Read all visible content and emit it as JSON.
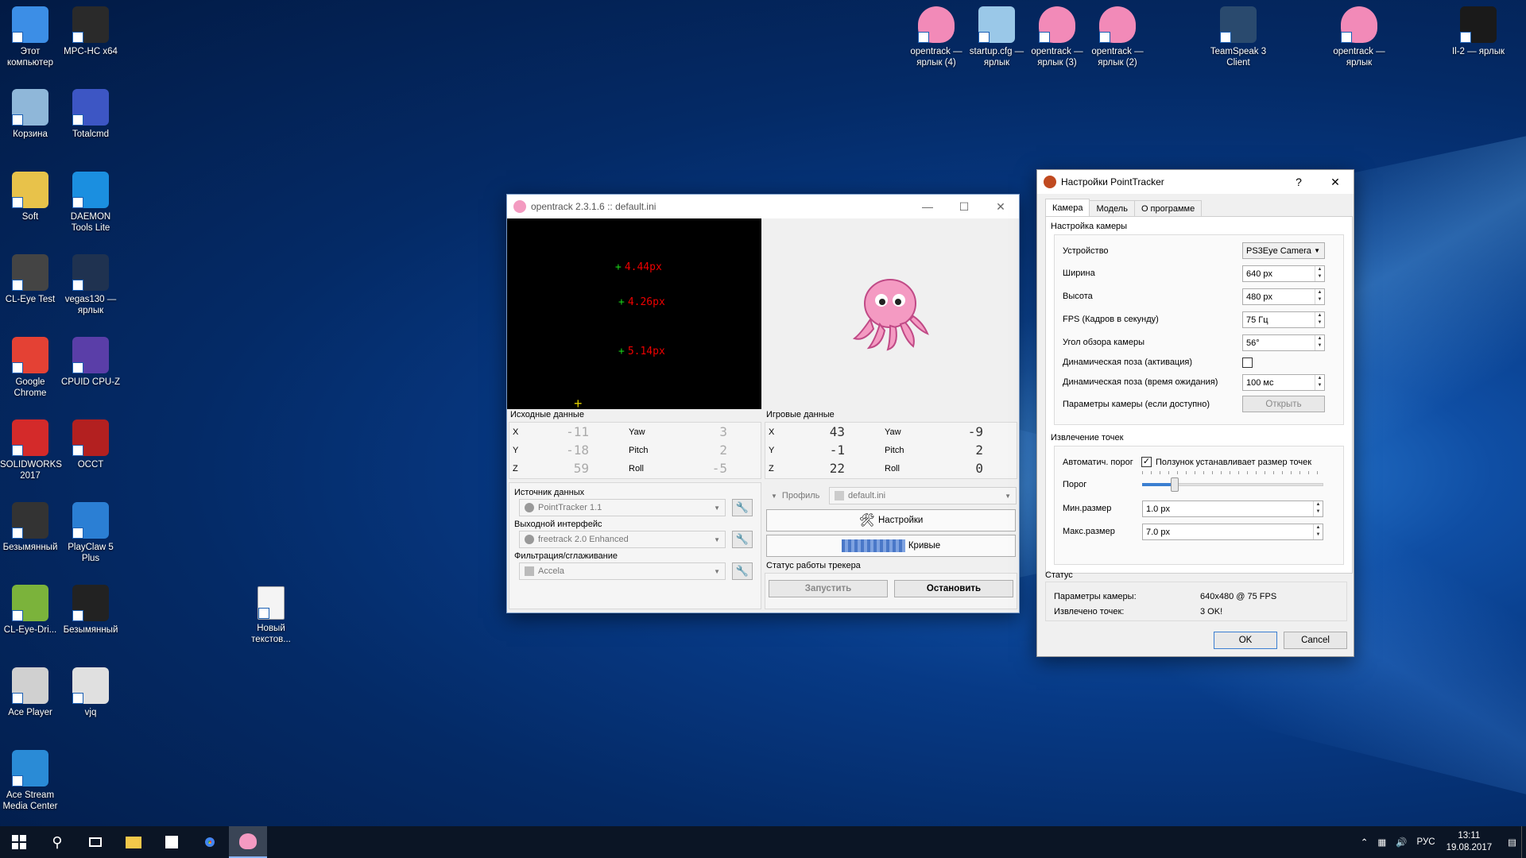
{
  "desktop": {
    "left_icons": [
      {
        "label": "Этот компьютер",
        "color": "#3c8ee6"
      },
      {
        "label": "MPC-HC x64",
        "color": "#2a2a2a"
      },
      {
        "label": "Корзина",
        "color": "#8fb7d9"
      },
      {
        "label": "Totalcmd",
        "color": "#3d56c4"
      },
      {
        "label": "Soft",
        "color": "#e8c24a"
      },
      {
        "label": "DAEMON Tools Lite",
        "color": "#1b8fe0"
      },
      {
        "label": "CL-Eye Test",
        "color": "#444444"
      },
      {
        "label": "vegas130 — ярлык",
        "color": "#1f3250"
      },
      {
        "label": "Google Chrome",
        "color": "#e44134"
      },
      {
        "label": "CPUID CPU-Z",
        "color": "#5a3ea8"
      },
      {
        "label": "SOLIDWORKS 2017",
        "color": "#d42a2a"
      },
      {
        "label": "OCCT",
        "color": "#b32020"
      },
      {
        "label": "Безымянный",
        "color": "#333333"
      },
      {
        "label": "PlayClaw 5 Plus",
        "color": "#2b7fd4"
      },
      {
        "label": "CL-Eye-Dri...",
        "color": "#7bb33b"
      },
      {
        "label": "Безымянный",
        "color": "#222222"
      },
      {
        "label": "Ace Player",
        "color": "#d0d0d0"
      },
      {
        "label": "vjq",
        "color": "#e0e0e0"
      },
      {
        "label": "Ace Stream Media Center",
        "color": "#2a8bd6"
      }
    ],
    "middle_icon": {
      "label": "Новый текстов...",
      "color": "#f4f4f4"
    },
    "top_icons": [
      {
        "label": "opentrack — ярлык (4)",
        "color": "#f28ab8"
      },
      {
        "label": "startup.cfg — ярлык",
        "color": "#9ac8e8"
      },
      {
        "label": "opentrack — ярлык (3)",
        "color": "#f28ab8"
      },
      {
        "label": "opentrack — ярлык (2)",
        "color": "#f28ab8"
      },
      {
        "label": "TeamSpeak 3 Client",
        "color": "#2a4a6e"
      },
      {
        "label": "opentrack — ярлык",
        "color": "#f28ab8"
      },
      {
        "label": "Il-2 — ярлык",
        "color": "#1a1a1a"
      }
    ]
  },
  "opentrack": {
    "title": "opentrack 2.3.1.6 :: default.ini",
    "points": [
      "4.44px",
      "4.26px",
      "5.14px"
    ],
    "raw_group": "Исходные данные",
    "game_group": "Игровые данные",
    "axes": {
      "x": "X",
      "y": "Y",
      "z": "Z",
      "yaw": "Yaw",
      "pitch": "Pitch",
      "roll": "Roll"
    },
    "raw_values": {
      "x": "-11",
      "y": "-18",
      "z": "59",
      "yaw": "3",
      "pitch": "2",
      "roll": "-5"
    },
    "game_values": {
      "x": "43",
      "y": "-1",
      "z": "22",
      "yaw": "-9",
      "pitch": "2",
      "roll": "0"
    },
    "source_label": "Источник данных",
    "source_value": "PointTracker 1.1",
    "output_label": "Выходной интерфейс",
    "output_value": "freetrack 2.0 Enhanced",
    "filter_label": "Фильтрация/сглаживание",
    "filter_value": "Accela",
    "profile_label": "Профиль",
    "profile_value": "default.ini",
    "settings_btn": "Настройки",
    "curves_btn": "Кривые",
    "status_label": "Статус работы трекера",
    "start_btn": "Запустить",
    "stop_btn": "Остановить"
  },
  "pointtracker": {
    "title": "Настройки PointTracker",
    "help": "?",
    "tabs": [
      "Камера",
      "Модель",
      "О программе"
    ],
    "camera_group": "Настройка камеры",
    "device_label": "Устройство",
    "device_value": "PS3Eye Camera",
    "width_label": "Ширина",
    "width_value": "640 px",
    "height_label": "Высота",
    "height_value": "480 px",
    "fps_label": "FPS (Кадров в секунду)",
    "fps_value": "75 Гц",
    "fov_label": "Угол обзора камеры",
    "fov_value": "56°",
    "dynpose_label": "Динамическая поза (активация)",
    "dynpose_checked": false,
    "dyntime_label": "Динамическая поза (время ожидания)",
    "dyntime_value": "100 мс",
    "camparams_label": "Параметры камеры (если доступно)",
    "open_btn": "Открыть",
    "extract_group": "Извлечение точек",
    "auto_label": "Автоматич. порог",
    "auto_checked": true,
    "auto_check_text": "Ползунок устанавливает размер точек",
    "threshold_label": "Порог",
    "threshold_level": 0.18,
    "minsize_label": "Мин.размер",
    "minsize_value": "1.0 px",
    "maxsize_label": "Макс.размер",
    "maxsize_value": "7.0 px",
    "status_group": "Статус",
    "camparams_status_label": "Параметры камеры:",
    "camparams_status_value": "640x480 @ 75 FPS",
    "extracted_label": "Извлечено точек:",
    "extracted_value": "3 OK!",
    "ok_btn": "OK",
    "cancel_btn": "Cancel"
  },
  "taskbar": {
    "lang": "РУС",
    "time": "13:11",
    "date": "19.08.2017"
  }
}
